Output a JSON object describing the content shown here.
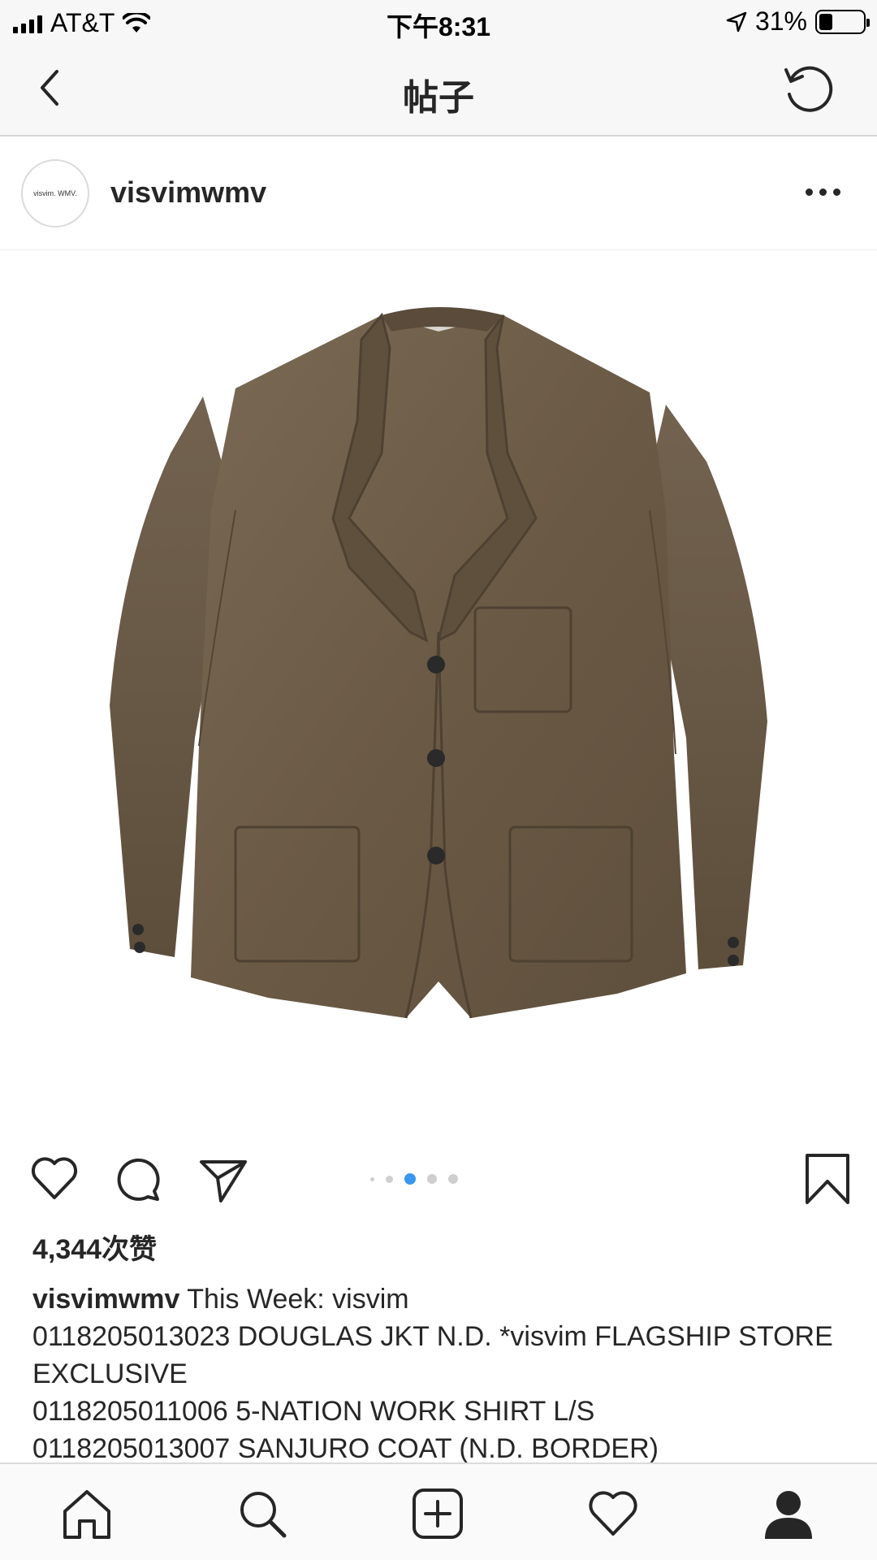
{
  "status_bar": {
    "carrier": "AT&T",
    "time": "下午8:31",
    "battery_percent": "31%",
    "battery_level": 0.31
  },
  "nav": {
    "title": "帖子",
    "icons": {
      "back": "chevron-left-icon",
      "refresh": "refresh-icon"
    }
  },
  "post": {
    "username": "visvimwmv",
    "avatar_text": "visvim. WMV.",
    "image_description_icon": "jacket-photo",
    "carousel": {
      "count": 5,
      "active_index": 2,
      "active_color": "#3897f0"
    },
    "likes": "4,344次赞",
    "caption": {
      "user": "visvimwmv",
      "first_line": " This Week: visvim",
      "lines": [
        "0118205013023 DOUGLAS JKT N.D. *visvim FLAGSHIP STORE EXCLUSIVE",
        "0118205011006 5-NATION WORK SHIRT L/S",
        "0118205013007 SANJURO COAT (N.D. BORDER)"
      ]
    }
  },
  "actions": {
    "icons": [
      "heart-icon",
      "comment-icon",
      "share-icon",
      "bookmark-icon"
    ]
  },
  "tab_bar": {
    "icons": [
      "home-icon",
      "search-icon",
      "add-post-icon",
      "activity-heart-icon",
      "profile-icon"
    ]
  },
  "colors": {
    "text": "#262626",
    "jacket": "#6f5e49",
    "accent": "#3897f0"
  }
}
